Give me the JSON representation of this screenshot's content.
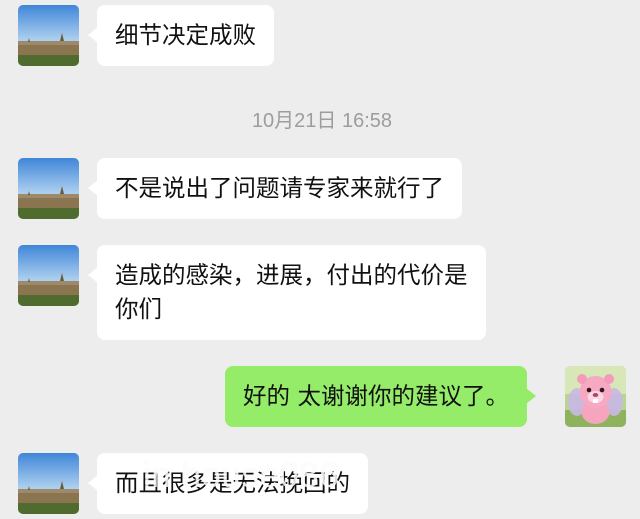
{
  "messages": [
    {
      "side": "left",
      "text": "细节决定成败"
    },
    {
      "side": "left",
      "text": "不是说出了问题请专家来就行了"
    },
    {
      "side": "left",
      "line1": "造成的感染，进展，付出的代价是",
      "line2": "你们"
    },
    {
      "side": "right",
      "text": "好的 太谢谢你的建议了。"
    },
    {
      "side": "left",
      "text": "而且很多是无法挽回的"
    }
  ],
  "timestamp": "10月21日 16:58",
  "watermark": "in house086",
  "avatars": {
    "contact": "landscape-avatar-icon",
    "self": "pink-beaver-avatar-icon"
  },
  "colors": {
    "background": "#ededed",
    "incoming_bubble": "#ffffff",
    "outgoing_bubble": "#95ec69",
    "timestamp": "#9d9d9d"
  }
}
